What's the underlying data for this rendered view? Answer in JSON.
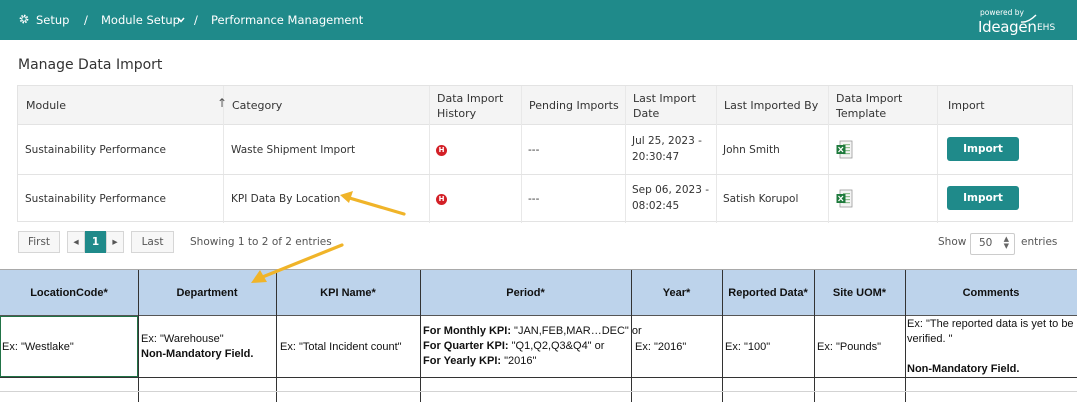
{
  "header": {
    "breadcrumbs": [
      "Setup",
      "/",
      "Module Setup",
      "/",
      "Performance Management"
    ],
    "powered_by": "powered by",
    "brand": "Ideagen",
    "brand_suffix": "EHS",
    "color": "#1f8a8a"
  },
  "page_title": "Manage Data Import",
  "table": {
    "columns": [
      "Module",
      "Category",
      "Data Import History",
      "Pending Imports",
      "Last Import Date",
      "Last Imported By",
      "Data Import Template",
      "Import"
    ],
    "column_lines": [
      [
        "Module"
      ],
      [
        "Category"
      ],
      [
        "Data Import",
        "History"
      ],
      [
        "Pending Imports"
      ],
      [
        "Last Import",
        "Date"
      ],
      [
        "Last Imported By"
      ],
      [
        "Data Import",
        "Template"
      ],
      [
        "Import"
      ]
    ],
    "sort_icon": "↑",
    "rows": [
      {
        "module": "Sustainability Performance",
        "category": "Waste Shipment Import",
        "history_icon": "H",
        "pending": "---",
        "date_line1": "Jul 25, 2023 -",
        "date_line2": "20:30:47",
        "imported_by": "John Smith",
        "import_label": "Import"
      },
      {
        "module": "Sustainability Performance",
        "category": "KPI Data By Location",
        "history_icon": "H",
        "pending": "---",
        "date_line1": "Sep 06, 2023 -",
        "date_line2": "08:02:45",
        "imported_by": "Satish Korupol",
        "import_label": "Import"
      }
    ]
  },
  "pagination": {
    "first": "First",
    "prev": "◂",
    "page": "1",
    "next": "▸",
    "last": "Last",
    "showing": "Showing 1 to 2 of 2 entries",
    "show_label": "Show",
    "page_size": "50",
    "entries_label": "entries"
  },
  "spreadsheet": {
    "headers": [
      "LocationCode*",
      "Department",
      "KPI Name*",
      "Period*",
      "Year*",
      "Reported Data*",
      "Site UOM*",
      "Comments"
    ],
    "location": "Ex: \"Westlake\"",
    "department_line1": "Ex: \"Warehouse\"",
    "department_line2": "Non-Mandatory Field.",
    "kpi_name": "Ex: \"Total Incident count\"",
    "period": [
      {
        "label": "For Monthly KPI:",
        "value": " \"JAN,FEB,MAR…DEC\" or"
      },
      {
        "label": "For Quarter KPI:",
        "value": " \"Q1,Q2,Q3&Q4\" or"
      },
      {
        "label": "For Yearly KPI:",
        "value": " \"2016\""
      }
    ],
    "year": "Ex: \"2016\"",
    "reported_data": "Ex: \"100\"",
    "site_uom": "Ex: \"Pounds\"",
    "comments_line1": "Ex: \"The reported data is yet to be",
    "comments_line2": "verified. \"",
    "comments_line3": "Non-Mandatory Field.",
    "header_color": "#bdd3eb"
  },
  "annotation_color": "#f0b429"
}
